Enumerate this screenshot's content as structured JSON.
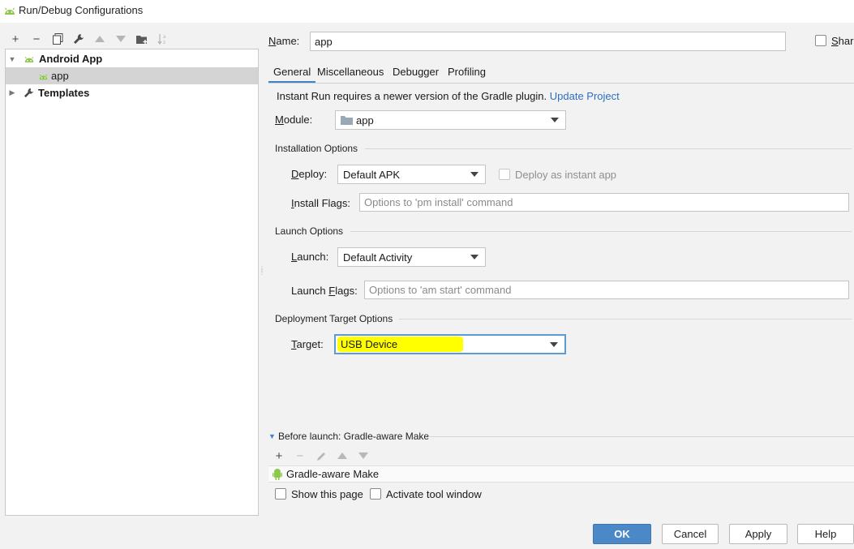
{
  "window": {
    "title": "Run/Debug Configurations"
  },
  "tree": {
    "android_app_label": "Android App",
    "app_label": "app",
    "templates_label": "Templates"
  },
  "name": {
    "label": "Name:",
    "value": "app",
    "share_label": "Share"
  },
  "tabs": {
    "general": "General",
    "misc": "Miscellaneous",
    "debugger": "Debugger",
    "profiling": "Profiling"
  },
  "notice": {
    "text": "Instant Run requires a newer version of the Gradle plugin.",
    "link": "Update Project"
  },
  "module": {
    "label": "Module:",
    "value": "app"
  },
  "installation": {
    "title": "Installation Options",
    "deploy_label": "Deploy:",
    "deploy_value": "Default APK",
    "instant_label": "Deploy as instant app",
    "flags_label": "Install Flags:",
    "flags_placeholder": "Options to 'pm install' command"
  },
  "launch": {
    "title": "Launch Options",
    "launch_label": "Launch:",
    "launch_value": "Default Activity",
    "flags_label": "Launch Flags:",
    "flags_placeholder": "Options to 'am start' command"
  },
  "deployment": {
    "title": "Deployment Target Options",
    "target_label": "Target:",
    "target_value": "USB Device"
  },
  "before_launch": {
    "title": "Before launch: Gradle-aware Make",
    "item": "Gradle-aware Make",
    "show_page": "Show this page",
    "activate_tool": "Activate tool window"
  },
  "buttons": {
    "ok": "OK",
    "cancel": "Cancel",
    "apply": "Apply",
    "help": "Help"
  },
  "colors": {
    "accent": "#4083c9",
    "primary_button": "#4a88c7",
    "highlight": "#ffff00",
    "link": "#2e6fc3",
    "android_green": "#8cc84b"
  }
}
